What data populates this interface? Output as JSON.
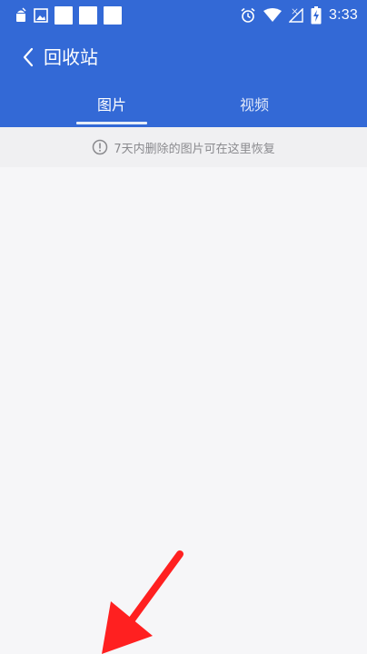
{
  "status_bar": {
    "time": "3:33",
    "left_icons": [
      "android-notification-icon",
      "image-notification-icon",
      "notification-square",
      "notification-square",
      "notification-square"
    ],
    "right_icons": [
      "alarm-icon",
      "wifi-icon",
      "signal-icon",
      "battery-charging-icon"
    ]
  },
  "header": {
    "title": "回收站",
    "back_icon": "chevron-left-icon"
  },
  "tabs": [
    {
      "label": "图片",
      "active": true
    },
    {
      "label": "视频",
      "active": false
    }
  ],
  "notice": {
    "icon": "info-icon",
    "text": "7天内删除的图片可在这里恢复"
  },
  "colors": {
    "header_bg": "#3369d6",
    "page_bg": "#f6f6f8",
    "notice_bg": "#f0f0f2",
    "annotation_arrow": "#ff2020"
  }
}
